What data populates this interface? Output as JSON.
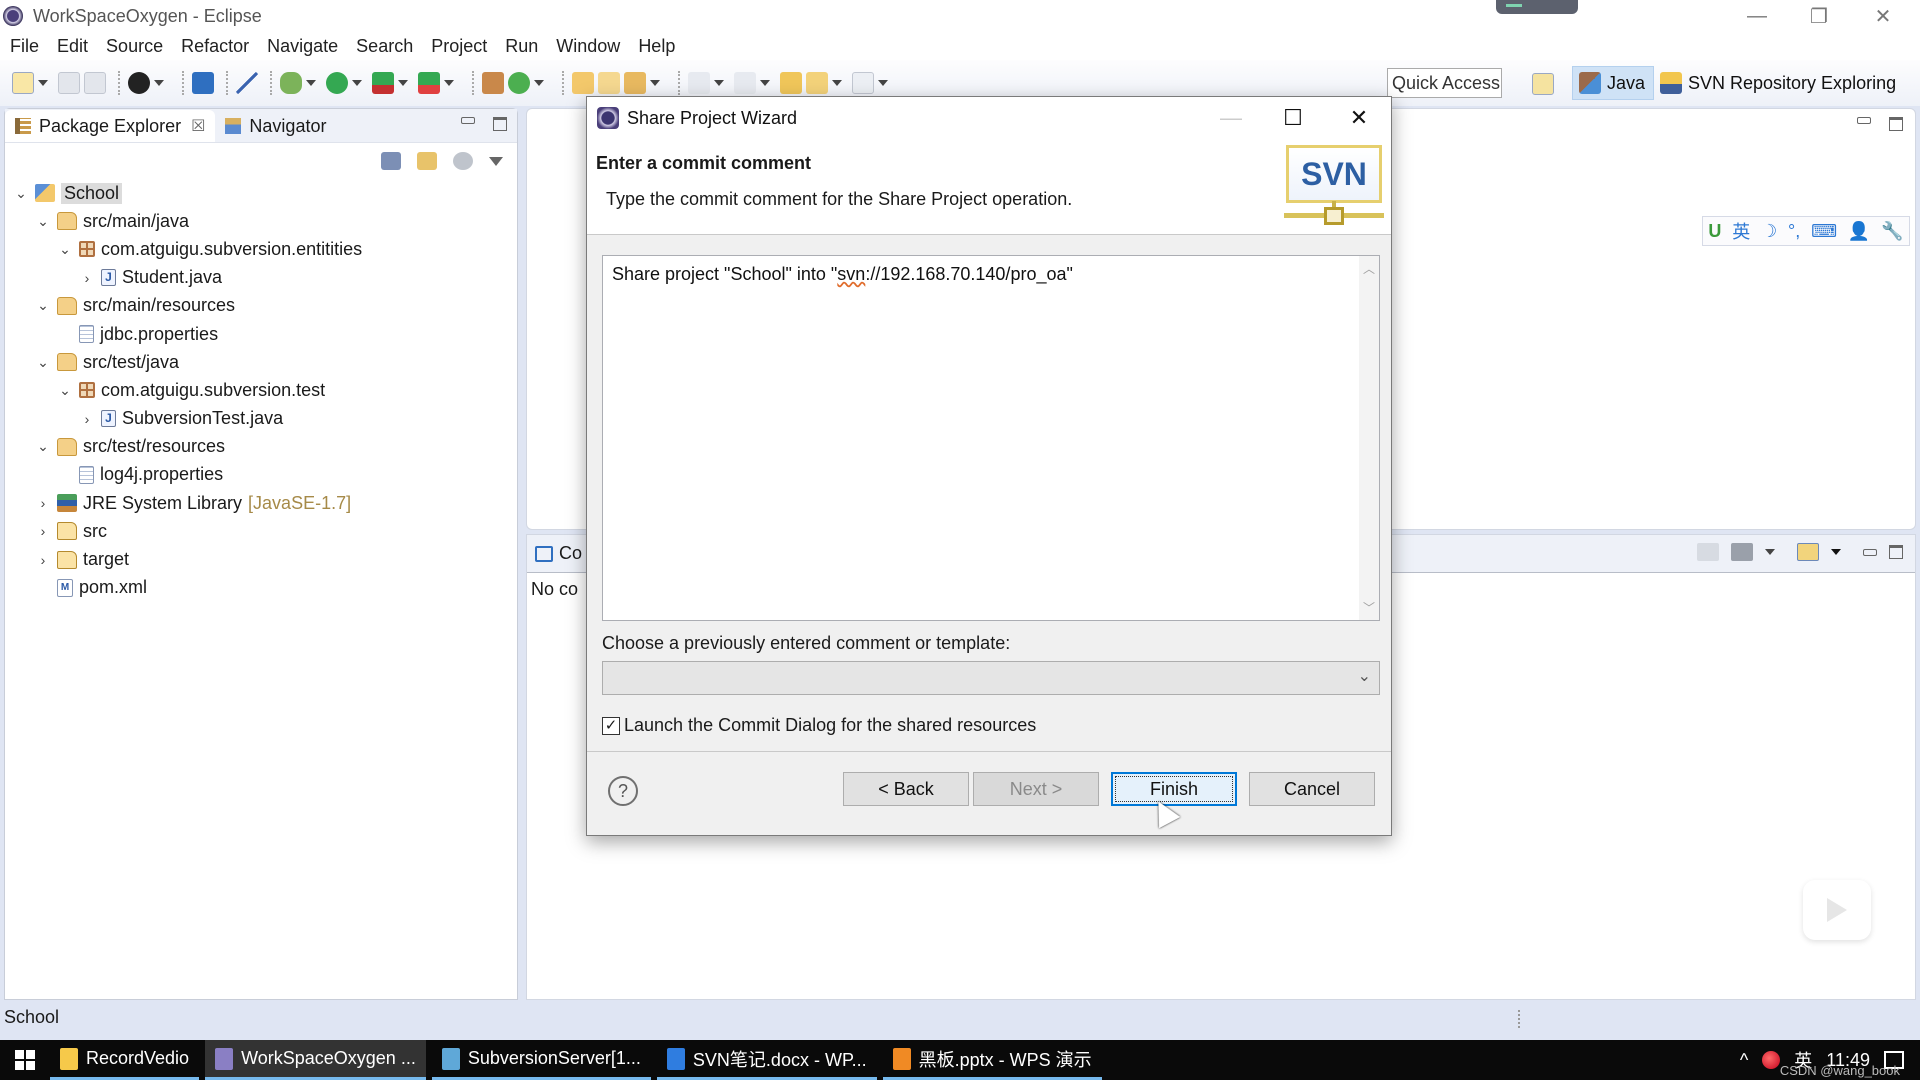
{
  "window": {
    "title": "WorkSpaceOxygen - Eclipse",
    "controls": {
      "minimize": "—",
      "restore": "❐",
      "close": "✕"
    }
  },
  "menu": [
    "File",
    "Edit",
    "Source",
    "Refactor",
    "Navigate",
    "Search",
    "Project",
    "Run",
    "Window",
    "Help"
  ],
  "toolbar": {
    "quick_access": "Quick Access",
    "perspectives": [
      {
        "label": "Java",
        "active": true,
        "icon": "java-perspective-icon"
      },
      {
        "label": "SVN Repository Exploring",
        "active": false,
        "icon": "svn-repository-icon"
      }
    ]
  },
  "package_explorer": {
    "tabs": [
      {
        "label": "Package Explorer",
        "active": true,
        "closable": true
      },
      {
        "label": "Navigator",
        "active": false
      }
    ],
    "tree": [
      {
        "label": "School",
        "depth": 0,
        "twisty": "open",
        "icon": "project",
        "selected": true
      },
      {
        "label": "src/main/java",
        "depth": 1,
        "twisty": "open",
        "icon": "srcfolder"
      },
      {
        "label": "com.atguigu.subversion.entitities",
        "depth": 2,
        "twisty": "open",
        "icon": "package"
      },
      {
        "label": "Student.java",
        "depth": 3,
        "twisty": "closed",
        "icon": "java"
      },
      {
        "label": "src/main/resources",
        "depth": 1,
        "twisty": "open",
        "icon": "srcfolder"
      },
      {
        "label": "jdbc.properties",
        "depth": 2,
        "twisty": "none",
        "icon": "props"
      },
      {
        "label": "src/test/java",
        "depth": 1,
        "twisty": "open",
        "icon": "srcfolder"
      },
      {
        "label": "com.atguigu.subversion.test",
        "depth": 2,
        "twisty": "open",
        "icon": "package"
      },
      {
        "label": "SubversionTest.java",
        "depth": 3,
        "twisty": "closed",
        "icon": "java"
      },
      {
        "label": "src/test/resources",
        "depth": 1,
        "twisty": "open",
        "icon": "srcfolder"
      },
      {
        "label": "log4j.properties",
        "depth": 2,
        "twisty": "none",
        "icon": "props"
      },
      {
        "label": "JRE System Library",
        "suffix": "[JavaSE-1.7]",
        "depth": 1,
        "twisty": "closed",
        "icon": "jre"
      },
      {
        "label": "src",
        "depth": 1,
        "twisty": "closed",
        "icon": "folder"
      },
      {
        "label": "target",
        "depth": 1,
        "twisty": "closed",
        "icon": "folder"
      },
      {
        "label": "pom.xml",
        "depth": 1,
        "twisty": "none",
        "icon": "pom"
      }
    ]
  },
  "console": {
    "tab_label_partial": "Co",
    "message_partial": "No co"
  },
  "ime_toolbar": [
    "U",
    "英",
    "☽",
    "°,",
    "⌨",
    "👤",
    "🔧"
  ],
  "status_bar": {
    "text": "School"
  },
  "dialog": {
    "title": "Share Project Wizard",
    "heading": "Enter a commit comment",
    "description": "Type the commit comment for the Share Project operation.",
    "logo_text": "SVN",
    "comment": {
      "before": "Share project \"School\" into \"",
      "misspelled": "svn",
      "after": "://192.168.70.140/pro_oa\""
    },
    "template_label": "Choose a previously entered comment or template:",
    "template_value": "",
    "checkbox": {
      "label": "Launch the Commit Dialog for the shared resources",
      "checked": true
    },
    "buttons": {
      "help": "?",
      "back": "< Back",
      "next": "Next >",
      "finish": "Finish",
      "cancel": "Cancel"
    }
  },
  "taskbar": {
    "items": [
      {
        "label": "RecordVedio",
        "active": false,
        "icon_color": "#f6c94a"
      },
      {
        "label": "WorkSpaceOxygen ...",
        "active": true,
        "icon_color": "#8a7fc4"
      },
      {
        "label": "SubversionServer[1...",
        "active": false,
        "icon_color": "#5fa8d8"
      },
      {
        "label": "SVN笔记.docx - WP...",
        "active": false,
        "icon_color": "#2f7de0"
      },
      {
        "label": "黑板.pptx - WPS 演示",
        "active": false,
        "icon_color": "#f08a24"
      }
    ],
    "tray": {
      "caret": "^",
      "ime": "英",
      "time": "11:49"
    },
    "watermark": "CSDN @wang_book"
  }
}
